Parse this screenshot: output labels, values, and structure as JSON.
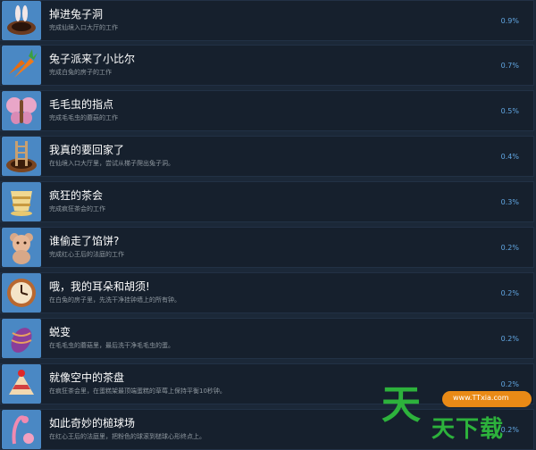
{
  "achievements": [
    {
      "title": "掉进兔子洞",
      "desc": "完成仙境入口大厅的工作",
      "pct": "0.9%",
      "icon": "rabbit-hole-icon"
    },
    {
      "title": "兔子派来了小比尔",
      "desc": "完成白兔的房子的工作",
      "pct": "0.7%",
      "icon": "carrot-icon"
    },
    {
      "title": "毛毛虫的指点",
      "desc": "完成毛毛虫的蘑菇的工作",
      "pct": "0.5%",
      "icon": "butterfly-icon"
    },
    {
      "title": "我真的要回家了",
      "desc": "在仙境入口大厅里，尝试从梯子爬出兔子洞。",
      "pct": "0.4%",
      "icon": "ladder-icon"
    },
    {
      "title": "疯狂的茶会",
      "desc": "完成疯狂茶会的工作",
      "pct": "0.3%",
      "icon": "teacup-icon"
    },
    {
      "title": "谁偷走了馅饼?",
      "desc": "完成红心王后的法庭的工作",
      "pct": "0.2%",
      "icon": "teddy-icon"
    },
    {
      "title": "哦，我的耳朵和胡须!",
      "desc": "在白兔的房子里，先洗干净挂钟墙上的所有钟。",
      "pct": "0.2%",
      "icon": "clock-icon"
    },
    {
      "title": "蜕变",
      "desc": "在毛毛虫的蘑菇里，最后洗干净毛毛虫的蛋。",
      "pct": "0.2%",
      "icon": "cocoon-icon"
    },
    {
      "title": "就像空中的茶盘",
      "desc": "在疯狂茶会里，在蛋糕架最顶端蛋糕的草莓上保持平衡10秒钟。",
      "pct": "0.2%",
      "icon": "cake-icon"
    },
    {
      "title": "如此奇妙的槌球场",
      "desc": "在红心王后的法庭里，把粉色的球滚到槌球心形终点上。",
      "pct": "0.2%",
      "icon": "flamingo-icon"
    }
  ],
  "watermark": {
    "big": "天",
    "small": "天下载",
    "url": "www.TTxia.com"
  }
}
